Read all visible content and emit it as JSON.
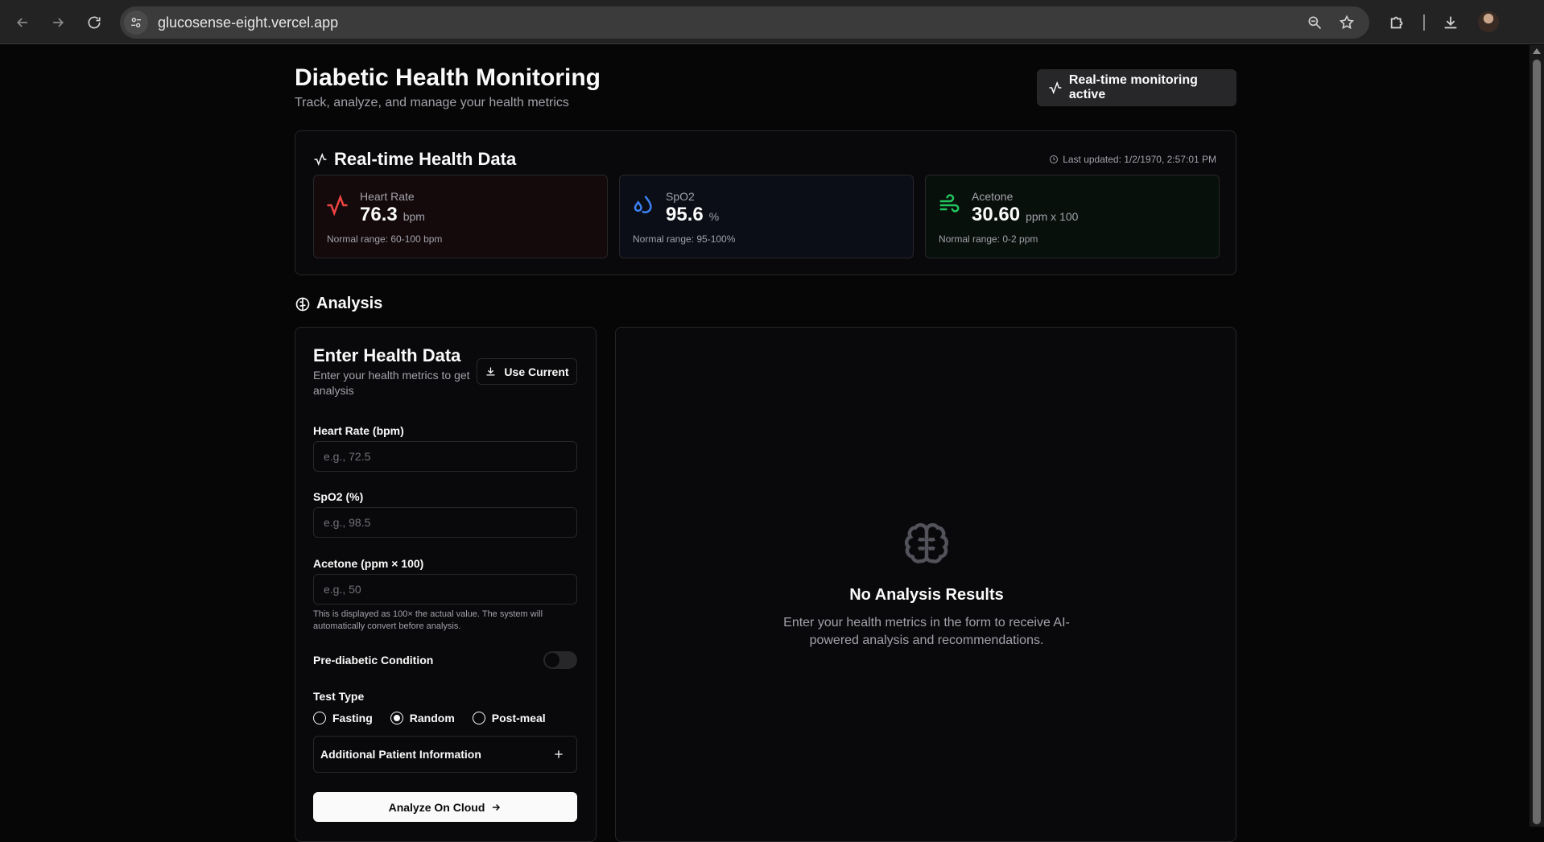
{
  "browser": {
    "url": "glucosense-eight.vercel.app"
  },
  "header": {
    "title": "Diabetic Health Monitoring",
    "subtitle": "Track, analyze, and manage your health metrics",
    "status": "Real-time monitoring active"
  },
  "realtime": {
    "title": "Real-time Health Data",
    "last_updated": "Last updated: 1/2/1970, 2:57:01 PM",
    "metrics": [
      {
        "label": "Heart Rate",
        "value": "76.3",
        "unit": "bpm",
        "range": "Normal range: 60-100 bpm",
        "icon": "activity-icon",
        "color": "#ef4444"
      },
      {
        "label": "SpO2",
        "value": "95.6",
        "unit": "%",
        "range": "Normal range: 95-100%",
        "icon": "droplets-icon",
        "color": "#3b82f6"
      },
      {
        "label": "Acetone",
        "value": "30.60",
        "unit": "ppm x 100",
        "range": "Normal range: 0-2 ppm",
        "icon": "wind-icon",
        "color": "#22c55e"
      }
    ]
  },
  "analysis": {
    "heading": "Analysis",
    "form": {
      "title": "Enter Health Data",
      "description": "Enter your health metrics to get analysis",
      "use_current": "Use Current",
      "heart_rate_label": "Heart Rate (bpm)",
      "heart_rate_placeholder": "e.g., 72.5",
      "spo2_label": "SpO2 (%)",
      "spo2_placeholder": "e.g., 98.5",
      "acetone_label": "Acetone (ppm × 100)",
      "acetone_placeholder": "e.g., 50",
      "acetone_hint": "This is displayed as 100× the actual value. The system will automatically convert before analysis.",
      "prediabetic_label": "Pre-diabetic Condition",
      "prediabetic_on": false,
      "test_type_label": "Test Type",
      "test_types": [
        "Fasting",
        "Random",
        "Post-meal"
      ],
      "test_type_selected": "Random",
      "additional_info": "Additional Patient Information",
      "submit": "Analyze On Cloud"
    },
    "results": {
      "empty_title": "No Analysis Results",
      "empty_description": "Enter your health metrics in the form to receive AI-powered analysis and recommendations."
    }
  }
}
